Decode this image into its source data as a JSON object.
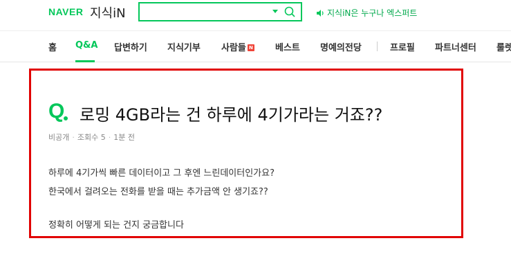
{
  "header": {
    "logo_naver": "NAVER",
    "logo_service": "지식iN",
    "search_value": "",
    "expert_link": "지식iN은 누구나 엑스퍼트"
  },
  "nav": {
    "items": [
      {
        "label": "홈"
      },
      {
        "label": "Q&A",
        "active": true
      },
      {
        "label": "답변하기"
      },
      {
        "label": "지식기부"
      },
      {
        "label": "사람들",
        "badge": "N"
      },
      {
        "label": "베스트"
      },
      {
        "label": "명예의전당"
      },
      {
        "label": "프로필"
      },
      {
        "label": "파트너센터"
      },
      {
        "label": "룰렛"
      }
    ]
  },
  "question": {
    "q_mark": "Q",
    "title": "로밍 4GB라는 건 하루에 4기가라는 거죠??",
    "meta": {
      "visibility": "비공개",
      "views_label": "조회수 5",
      "time": "1분 전"
    },
    "body_lines": [
      "하루에 4기가씩 빠른 데이터이고 그 후엔 느린데이터인가요?",
      "한국에서 걸려오는 전화를 받을 때는 추가금액 안 생기죠??",
      "정확히 어떻게 되는 건지 궁금합니다"
    ]
  },
  "colors": {
    "brand_green": "#03c75a",
    "highlight_border": "#e10000"
  }
}
